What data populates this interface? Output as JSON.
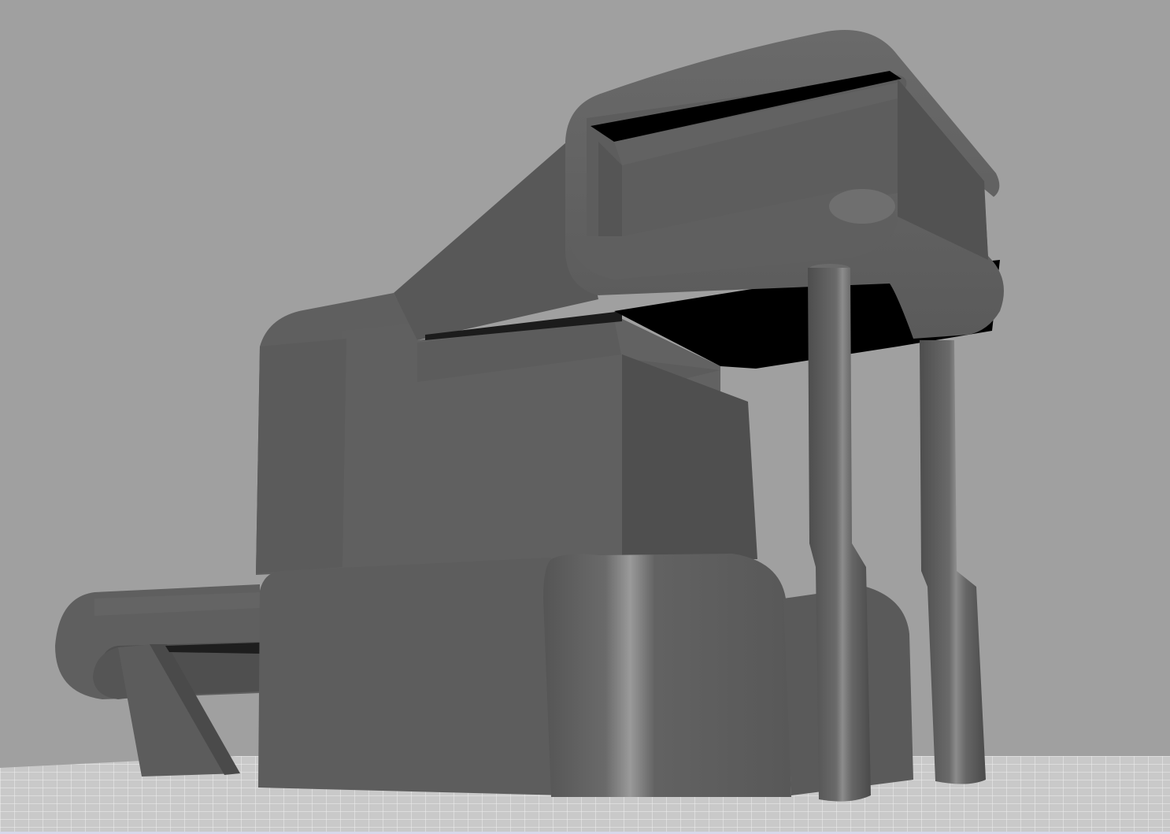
{
  "viewport": {
    "background_color": "#a0a0a0",
    "border_color": "#3b2fb0",
    "grid_color": "#d6d6d6",
    "shade_dark": "#4a4a4a",
    "shade_mid": "#5e5e5e",
    "shade_light": "#6c6c6c",
    "highlight": "#9a9a9a",
    "shadow": "#000000"
  },
  "scene": {
    "object_icon": "bench-vise-model-icon"
  }
}
